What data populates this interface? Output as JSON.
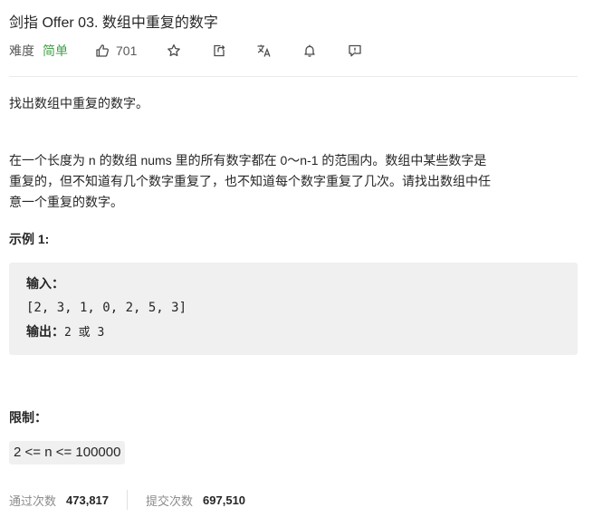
{
  "problem": {
    "title": "剑指 Offer 03. 数组中重复的数字",
    "difficulty_label": "难度",
    "difficulty": "简单",
    "likes": "701"
  },
  "description": {
    "line1": "找出数组中重复的数字。",
    "line2": "在一个长度为 n 的数组 nums 里的所有数字都在 0～n-1 的范围内。数组中某些数字是",
    "line3": "重复的，但不知道有几个数字重复了，也不知道每个数字重复了几次。请找出数组中任",
    "line4": "意一个重复的数字。"
  },
  "example": {
    "heading": "示例 1:",
    "input_label": "输入：",
    "input_value": "[2, 3, 1, 0, 2, 5, 3]",
    "output_label": "输出：",
    "output_value": "2 或 3"
  },
  "constraints": {
    "heading": "限制：",
    "item": "2 <= n <= 100000"
  },
  "stats": {
    "accepted_label": "通过次数",
    "accepted_value": "473,817",
    "submitted_label": "提交次数",
    "submitted_value": "697,510"
  },
  "icons": [
    "thumbs-up-icon",
    "star-icon",
    "share-icon",
    "translate-icon",
    "bell-icon",
    "feedback-icon"
  ],
  "colors": {
    "difficulty_easy": "#43a047",
    "code_bg": "#f0f0f0"
  }
}
